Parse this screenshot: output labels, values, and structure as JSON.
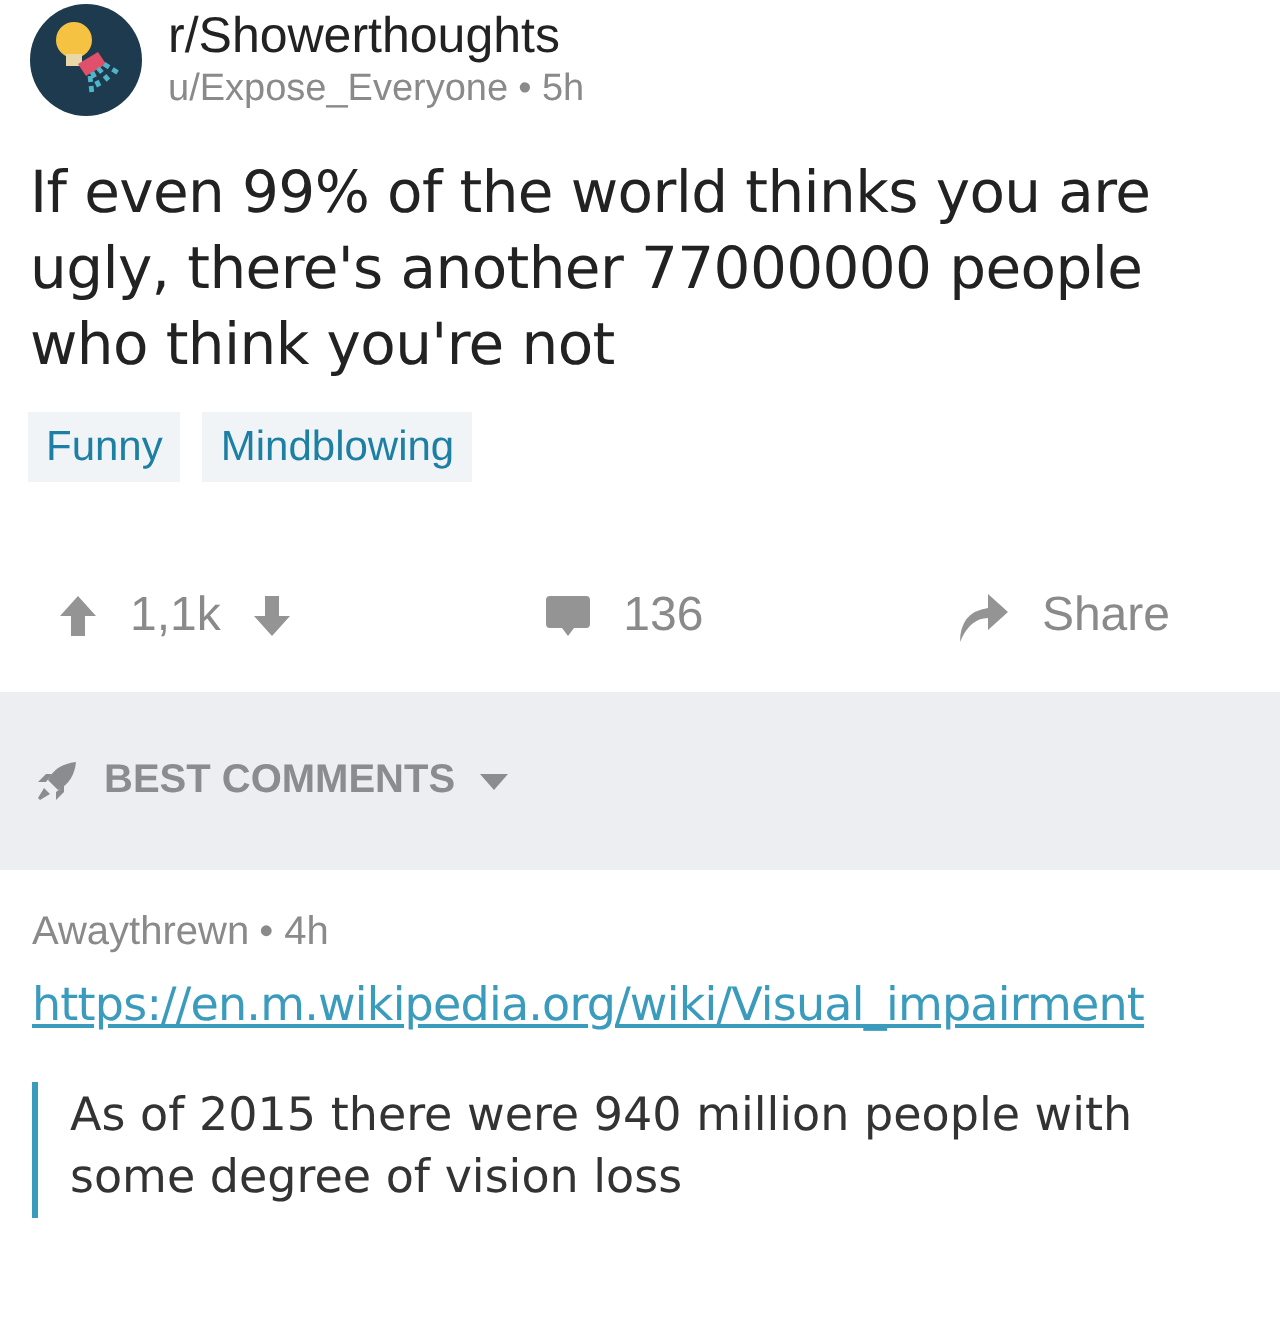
{
  "post": {
    "subreddit": "r/Showerthoughts",
    "author": "u/Expose_Everyone",
    "age": "• 5h",
    "title": "If even 99% of the world thinks you are ugly, there's another 77000000 people who think you're not",
    "flairs": [
      "Funny",
      "Mindblowing"
    ],
    "score": "1,1k",
    "comments": "136",
    "share": "Share"
  },
  "sort": {
    "label": "BEST COMMENTS"
  },
  "comments": [
    {
      "author": "Awaythrewn",
      "age": "• 4h",
      "link": "https://en.m.wikipedia.org/wiki/Visual_impairment",
      "quote": "As of 2015 there were 940 million people with some degree of vision loss"
    }
  ]
}
